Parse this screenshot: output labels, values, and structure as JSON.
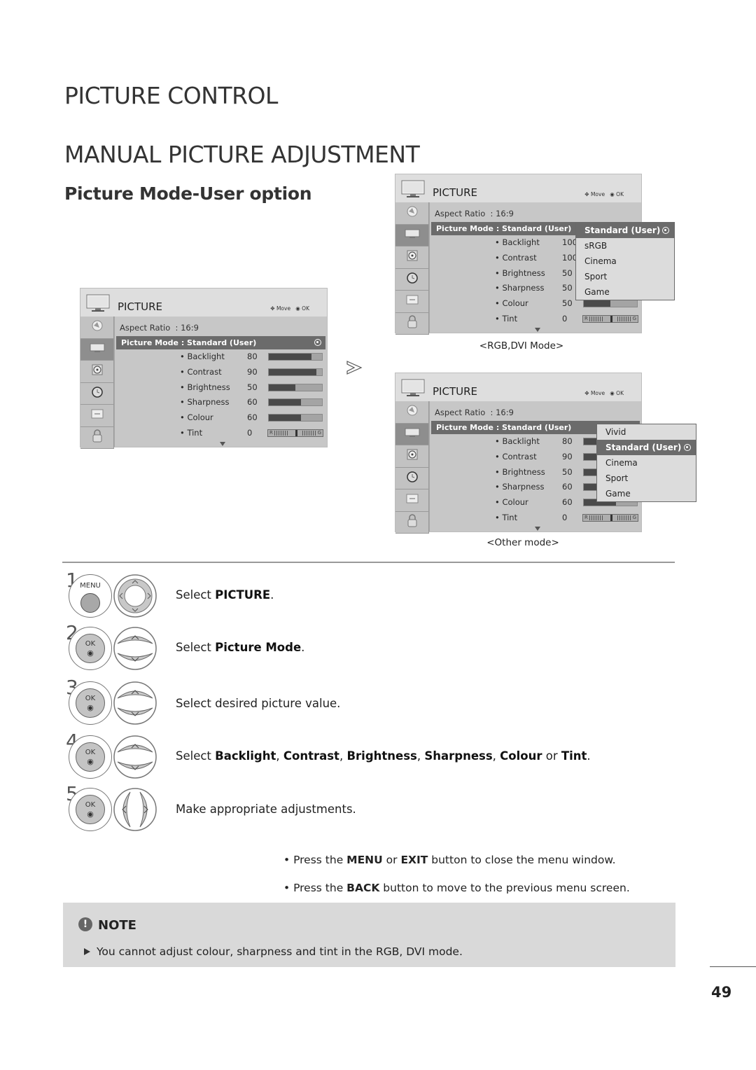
{
  "page": {
    "section_title": "PICTURE CONTROL",
    "heading": "MANUAL PICTURE ADJUSTMENT",
    "subheading": "Picture Mode-User option",
    "page_number": "49"
  },
  "menus": {
    "main": {
      "title": "PICTURE",
      "hint_move": "Move",
      "hint_ok": "OK",
      "aspect_label": "Aspect Ratio",
      "aspect_value": ": 16:9",
      "mode_row": "Picture Mode : Standard (User)",
      "settings": [
        {
          "label": "• Backlight",
          "value": "80",
          "fraction": 0.8
        },
        {
          "label": "• Contrast",
          "value": "90",
          "fraction": 0.9
        },
        {
          "label": "• Brightness",
          "value": "50",
          "fraction": 0.5
        },
        {
          "label": "• Sharpness",
          "value": "60",
          "fraction": 0.6
        },
        {
          "label": "• Colour",
          "value": "60",
          "fraction": 0.6
        },
        {
          "label": "• Tint",
          "value": "0",
          "tint": true
        }
      ],
      "tint_left": "R",
      "tint_right": "G"
    },
    "rgb": {
      "title": "PICTURE",
      "hint_move": "Move",
      "hint_ok": "OK",
      "aspect_label": "Aspect Ratio",
      "aspect_value": ": 16:9",
      "mode_row": "Picture Mode : Standard (User)",
      "settings": [
        {
          "label": "• Backlight",
          "value": "100",
          "fraction": 1.0
        },
        {
          "label": "• Contrast",
          "value": "100",
          "fraction": 1.0
        },
        {
          "label": "• Brightness",
          "value": "50",
          "fraction": 0.5
        },
        {
          "label": "• Sharpness",
          "value": "50",
          "fraction": 0.5
        },
        {
          "label": "• Colour",
          "value": "50",
          "fraction": 0.5
        },
        {
          "label": "• Tint",
          "value": "0",
          "tint": true
        }
      ],
      "tint_left": "R",
      "tint_right": "G",
      "dropdown": [
        "Standard (User)",
        "sRGB",
        "Cinema",
        "Sport",
        "Game"
      ],
      "dropdown_selected": 0,
      "caption": "<RGB,DVI Mode>"
    },
    "other": {
      "title": "PICTURE",
      "hint_move": "Move",
      "hint_ok": "OK",
      "aspect_label": "Aspect Ratio",
      "aspect_value": ": 16:9",
      "mode_row": "Picture Mode : Standard (User)",
      "settings": [
        {
          "label": "• Backlight",
          "value": "80",
          "fraction": 0.8
        },
        {
          "label": "• Contrast",
          "value": "90",
          "fraction": 0.9
        },
        {
          "label": "• Brightness",
          "value": "50",
          "fraction": 0.5
        },
        {
          "label": "• Sharpness",
          "value": "60",
          "fraction": 0.6
        },
        {
          "label": "• Colour",
          "value": "60",
          "fraction": 0.6
        },
        {
          "label": "• Tint",
          "value": "0",
          "tint": true
        }
      ],
      "tint_left": "R",
      "tint_right": "G",
      "dropdown": [
        "Vivid",
        "Standard (User)",
        "Cinema",
        "Sport",
        "Game"
      ],
      "dropdown_selected": 1,
      "caption": "<Other mode>"
    }
  },
  "steps": [
    {
      "num": "1",
      "button": "MENU",
      "nav": "4-way",
      "pre": "Select ",
      "bold": "PICTURE",
      "post": "."
    },
    {
      "num": "2",
      "button": "OK",
      "nav": "up-down",
      "pre": "Select ",
      "bold": "Picture Mode",
      "post": "."
    },
    {
      "num": "3",
      "button": "OK",
      "nav": "up-down",
      "pre": "Select desired picture value.",
      "bold": "",
      "post": ""
    },
    {
      "num": "4",
      "button": "OK",
      "nav": "up-down",
      "parts": [
        {
          "t": "Select ",
          "b": false
        },
        {
          "t": "Backlight",
          "b": true
        },
        {
          "t": ", ",
          "b": false
        },
        {
          "t": "Contrast",
          "b": true
        },
        {
          "t": ", ",
          "b": false
        },
        {
          "t": "Brightness",
          "b": true
        },
        {
          "t": ", ",
          "b": false
        },
        {
          "t": "Sharpness",
          "b": true
        },
        {
          "t": ", ",
          "b": false
        },
        {
          "t": "Colour",
          "b": true
        },
        {
          "t": " or ",
          "b": false
        },
        {
          "t": "Tint",
          "b": true
        },
        {
          "t": ".",
          "b": false
        }
      ]
    },
    {
      "num": "5",
      "button": "OK",
      "nav": "left-right",
      "pre": "Make appropriate adjustments.",
      "bold": "",
      "post": ""
    }
  ],
  "tips": [
    {
      "parts": [
        {
          "t": "• Press the ",
          "b": false
        },
        {
          "t": "MENU",
          "b": true
        },
        {
          "t": " or ",
          "b": false
        },
        {
          "t": "EXIT",
          "b": true
        },
        {
          "t": " button to close the menu window.",
          "b": false
        }
      ]
    },
    {
      "parts": [
        {
          "t": "• Press the ",
          "b": false
        },
        {
          "t": "BACK",
          "b": true
        },
        {
          "t": " button to move to the previous menu screen.",
          "b": false
        }
      ]
    }
  ],
  "note": {
    "icon": "!",
    "title": "NOTE",
    "text": "You cannot adjust colour, sharpness and tint in the RGB, DVI mode."
  },
  "icons": {
    "sidebar": [
      "satellite-icon",
      "picture-icon",
      "speaker-icon",
      "clock-icon",
      "option-icon",
      "lock-icon"
    ],
    "ok_glyph": "◉"
  }
}
